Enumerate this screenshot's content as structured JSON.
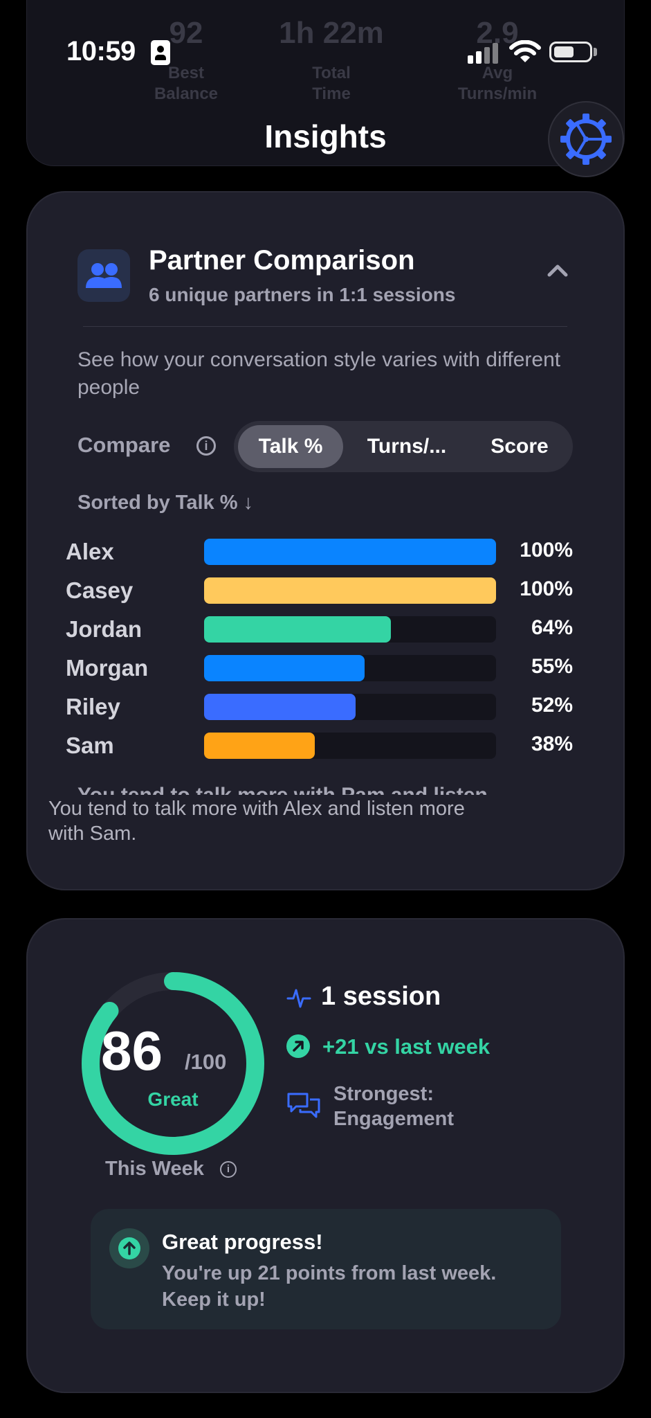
{
  "status_bar": {
    "time": "10:59"
  },
  "background_card": {
    "stats": [
      {
        "value": "92",
        "label_line1": "Best",
        "label_line2": "Balance"
      },
      {
        "value": "1h 22m",
        "label_line1": "Total",
        "label_line2": "Time"
      },
      {
        "value": "2.9",
        "label_line1": "Avg",
        "label_line2": "Turns/min"
      }
    ]
  },
  "header": {
    "title": "Insights",
    "settings_icon": "gear-icon"
  },
  "partner_comparison": {
    "title": "Partner Comparison",
    "subtitle": "6 unique partners in 1:1 sessions",
    "description": "See how your conversation style varies with different people",
    "compare_label": "Compare",
    "info_glyph": "i",
    "segments": [
      {
        "label": "Talk %",
        "active": true
      },
      {
        "label": "Turns/...",
        "active": false
      },
      {
        "label": "Score",
        "active": false
      }
    ],
    "sorted_label": "Sorted by Talk % ↓",
    "bars": [
      {
        "name": "Alex",
        "value": 100,
        "label": "100%",
        "color": "#0a84ff"
      },
      {
        "name": "Casey",
        "value": 100,
        "label": "100%",
        "color": "#ffc95c"
      },
      {
        "name": "Jordan",
        "value": 64,
        "label": "64%",
        "color": "#34d4a4"
      },
      {
        "name": "Morgan",
        "value": 55,
        "label": "55%",
        "color": "#0a84ff"
      },
      {
        "name": "Riley",
        "value": 52,
        "label": "52%",
        "color": "#3a6cff"
      },
      {
        "name": "Sam",
        "value": 38,
        "label": "38%",
        "color": "#ffa316"
      }
    ],
    "clipped_text": "You tend to talk more with Pam and listen",
    "insight": "You tend to talk more with Alex and listen more with Sam."
  },
  "weekly_score": {
    "score": "86",
    "max": "/100",
    "rating": "Great",
    "progress": 0.86,
    "period_label": "This Week",
    "sessions": "1 session",
    "change": "+21 vs last week",
    "strongest_line1": "Strongest:",
    "strongest_line2": "Engagement",
    "colors": {
      "accent": "#34d4a4",
      "blue": "#3a6cff"
    }
  },
  "progress_banner": {
    "title": "Great progress!",
    "text": "You're up 21 points from last week. Keep it up!"
  }
}
